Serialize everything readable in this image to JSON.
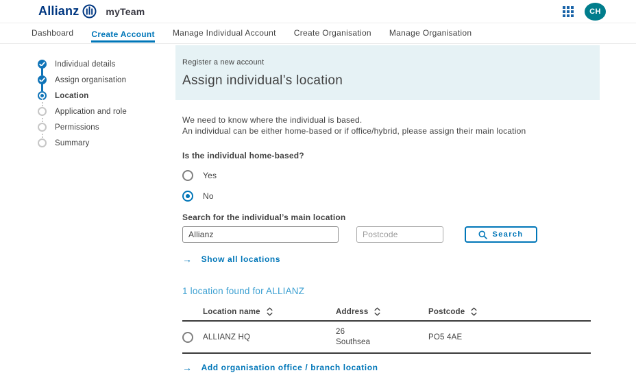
{
  "header": {
    "brand": "Allianz",
    "app_name": "myTeam",
    "avatar_initials": "CH"
  },
  "nav": {
    "items": [
      {
        "label": "Dashboard",
        "active": false
      },
      {
        "label": "Create Account",
        "active": true
      },
      {
        "label": "Manage Individual Account",
        "active": false
      },
      {
        "label": "Create Organisation",
        "active": false
      },
      {
        "label": "Manage Organisation",
        "active": false
      }
    ]
  },
  "stepper": {
    "steps": [
      {
        "label": "Individual details",
        "state": "complete"
      },
      {
        "label": "Assign organisation",
        "state": "complete"
      },
      {
        "label": "Location",
        "state": "current"
      },
      {
        "label": "Application and role",
        "state": "upcoming"
      },
      {
        "label": "Permissions",
        "state": "upcoming"
      },
      {
        "label": "Summary",
        "state": "upcoming"
      }
    ]
  },
  "banner": {
    "eyebrow": "Register a new account",
    "title": "Assign individual’s location"
  },
  "content": {
    "intro_line1": "We need to know where the individual is based.",
    "intro_line2": "An individual can be either home-based or if office/hybrid, please assign their main location",
    "home_based_question": "Is the individual home-based?",
    "radio_yes": "Yes",
    "radio_no": "No",
    "home_based_answer": "No",
    "search_label": "Search for the individual’s main location",
    "search_value": "Allianz",
    "postcode_placeholder": "Postcode",
    "search_button": "Search",
    "show_all_link": "Show all locations",
    "results_summary": "1 location found for ALLIANZ",
    "add_location_link": "Add organisation office / branch location"
  },
  "table": {
    "columns": [
      "Location name",
      "Address",
      "Postcode"
    ],
    "rows": [
      {
        "location_name": "ALLIANZ HQ",
        "address_line1": "26",
        "address_line2": "Southsea",
        "postcode": "PO5 4AE",
        "selected": false
      }
    ]
  },
  "icons": {
    "apps": "grid-3x3-dots",
    "search": "magnifier",
    "link_arrow": "→",
    "sort": "up-down-chevrons",
    "step_complete": "checkmark"
  },
  "colors": {
    "brand_blue": "#003781",
    "action_blue": "#0076b8",
    "step_blue": "#1074b8",
    "banner_bg": "#e6f2f5",
    "results_blue": "#3a9fd1",
    "avatar_teal": "#007d8c",
    "text": "#414141"
  }
}
